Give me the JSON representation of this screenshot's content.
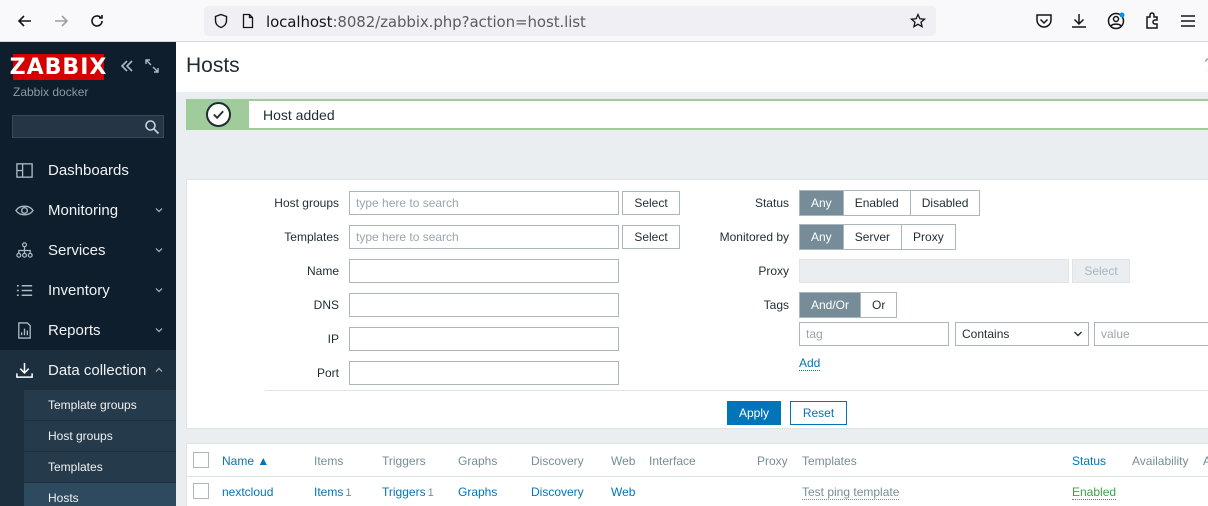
{
  "browser": {
    "url_host": "localhost",
    "url_rest": ":8082/zabbix.php?action=host.list"
  },
  "sidebar": {
    "logo": "ZABBIX",
    "server_name": "Zabbix docker",
    "menu": [
      {
        "label": "Dashboards",
        "icon": "dashboards-icon"
      },
      {
        "label": "Monitoring",
        "icon": "eye-icon"
      },
      {
        "label": "Services",
        "icon": "services-icon"
      },
      {
        "label": "Inventory",
        "icon": "list-icon"
      },
      {
        "label": "Reports",
        "icon": "reports-icon"
      },
      {
        "label": "Data collection",
        "icon": "download-icon"
      }
    ],
    "submenu": [
      "Template groups",
      "Host groups",
      "Templates",
      "Hosts"
    ]
  },
  "page": {
    "title": "Hosts",
    "help": "?",
    "message": "Host added"
  },
  "filter": {
    "host_groups_label": "Host groups",
    "templates_label": "Templates",
    "name_label": "Name",
    "dns_label": "DNS",
    "ip_label": "IP",
    "port_label": "Port",
    "search_placeholder": "type here to search",
    "select_label": "Select",
    "status_label": "Status",
    "status_options": [
      "Any",
      "Enabled",
      "Disabled"
    ],
    "monitored_by_label": "Monitored by",
    "monitored_by_options": [
      "Any",
      "Server",
      "Proxy"
    ],
    "proxy_label": "Proxy",
    "tags_label": "Tags",
    "tags_options": [
      "And/Or",
      "Or"
    ],
    "tag_placeholder": "tag",
    "tag_operator": "Contains",
    "value_placeholder": "value",
    "add_label": "Add",
    "apply_label": "Apply",
    "reset_label": "Reset"
  },
  "table": {
    "headers": {
      "name": "Name ▲",
      "items": "Items",
      "triggers": "Triggers",
      "graphs": "Graphs",
      "discovery": "Discovery",
      "web": "Web",
      "interface": "Interface",
      "proxy": "Proxy",
      "templates": "Templates",
      "status": "Status",
      "availability": "Availability",
      "extra": "A"
    },
    "rows": [
      {
        "name": "nextcloud",
        "items": "Items",
        "items_count": "1",
        "triggers": "Triggers",
        "triggers_count": "1",
        "graphs": "Graphs",
        "discovery": "Discovery",
        "web": "Web",
        "templates": "Test ping template",
        "status": "Enabled"
      }
    ]
  }
}
